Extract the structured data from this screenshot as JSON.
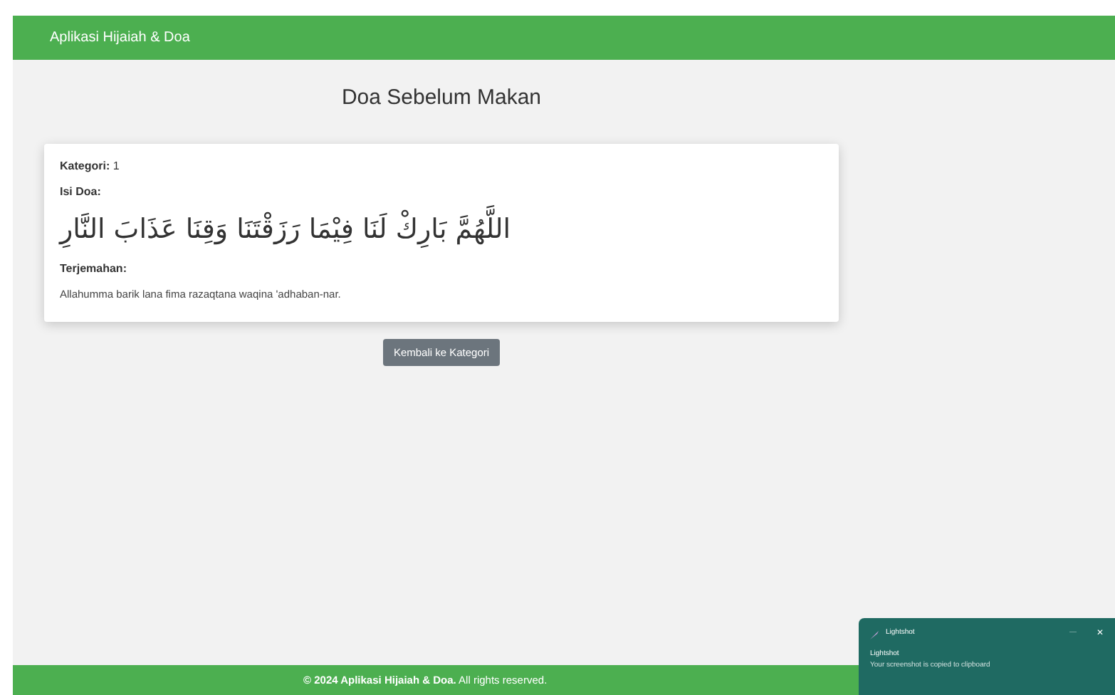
{
  "navbar": {
    "brand": "Aplikasi Hijaiah & Doa"
  },
  "page": {
    "title": "Doa Sebelum Makan"
  },
  "card": {
    "category_label": "Kategori:",
    "category_value": "1",
    "doa_label": "Isi Doa:",
    "arabic": "اللَّهُمَّ بَارِكْ لَنَا فِيْمَا رَزَقْتَنَا وَقِنَا عَذَابَ النَّارِ",
    "translation_label": "Terjemahan:",
    "translation": "Allahumma barik lana fima razaqtana waqina 'adhaban-nar."
  },
  "back_button": "Kembali ke Kategori",
  "footer": "**© 2024 Aplikasi Hijaiah & Doa.** All rights reserved.",
  "toast": {
    "app": "Lightshot",
    "title": "Lightshot",
    "message": "Your screenshot is copied to clipboard",
    "minimize": "—",
    "close": "✕"
  }
}
